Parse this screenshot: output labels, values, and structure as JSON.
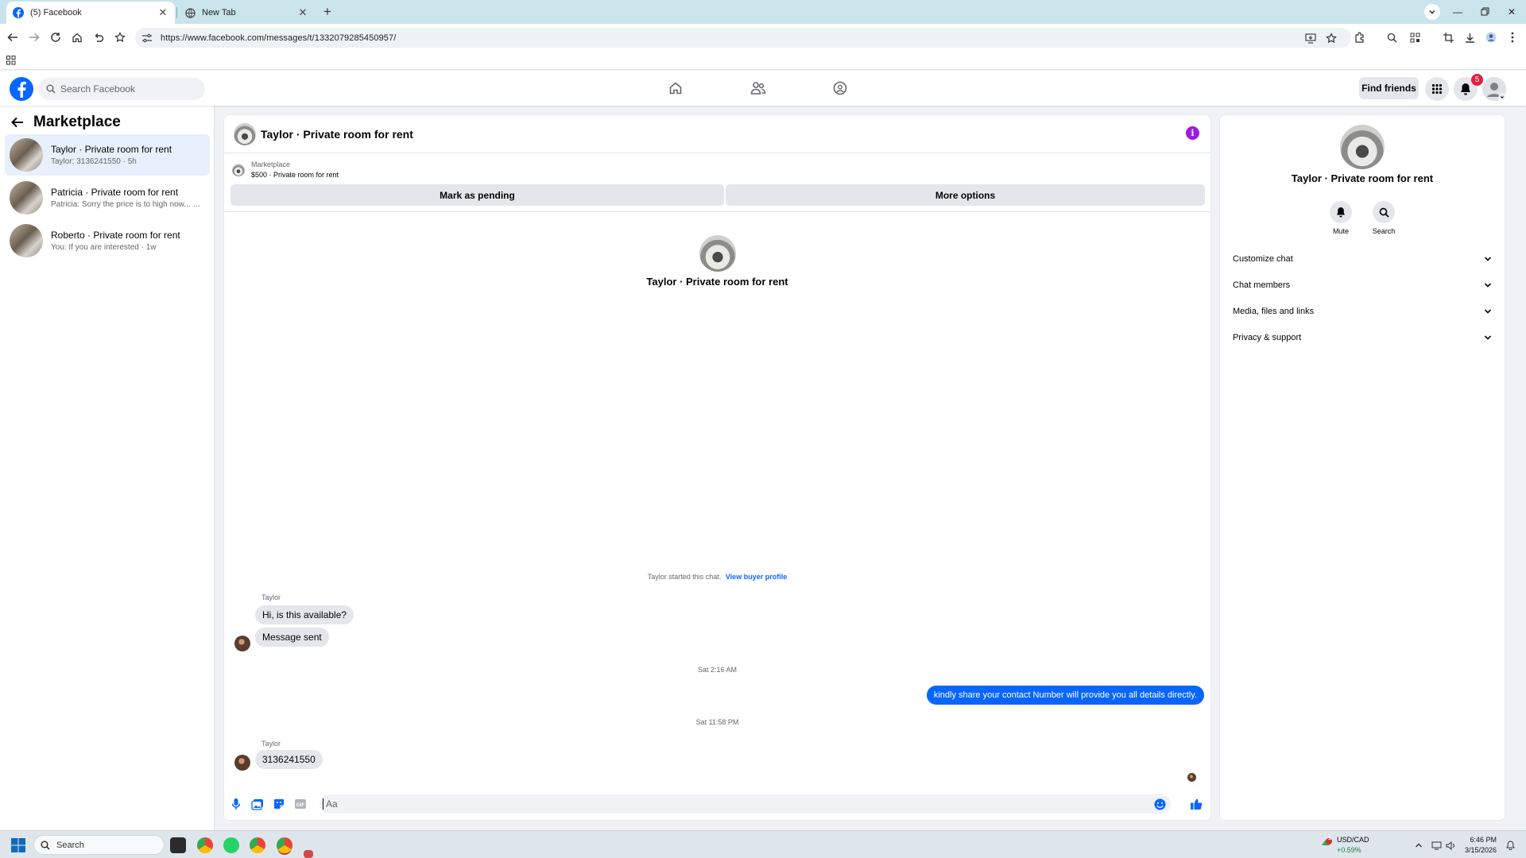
{
  "browser": {
    "tabs": [
      {
        "title": "(5) Facebook",
        "active": true
      },
      {
        "title": "New Tab",
        "active": false
      }
    ],
    "url": "https://www.facebook.com/messages/t/1332079285450957/"
  },
  "fb_header": {
    "search_placeholder": "Search Facebook",
    "find_friends_label": "Find friends",
    "notification_count": "5",
    "brand_color": "#0866ff"
  },
  "sidebar": {
    "title": "Marketplace",
    "conversations": [
      {
        "name": "Taylor · Private room for rent",
        "preview": "Taylor: 3136241550 · 5h",
        "active": true
      },
      {
        "name": "Patricia · Private room for rent",
        "preview": "Patricia: Sorry the price is to high now... · 1w",
        "active": false
      },
      {
        "name": "Roberto · Private room for rent",
        "preview": "You: If you are interested · 1w",
        "active": false
      }
    ]
  },
  "chat": {
    "title": "Taylor · Private room for rent",
    "listing_source": "Marketplace",
    "listing_price_title": "$500 · Private room for rent",
    "mark_pending_label": "Mark as pending",
    "more_options_label": "More options",
    "center_name": "Taylor · Private room for rent",
    "started_text": "Taylor started this chat.",
    "view_buyer_profile": "View buyer profile",
    "messages": [
      {
        "sender": "Taylor",
        "text": "Hi, is this available?"
      },
      {
        "text": "Message sent"
      },
      {
        "timestamp": "Sat 2:16 AM"
      },
      {
        "outgoing": "kindly share your contact Number will provide you all details directly."
      },
      {
        "timestamp": "Sat 11:58 PM"
      },
      {
        "sender": "Taylor",
        "text": "3136241550"
      }
    ],
    "composer_placeholder": "Aa"
  },
  "info_panel": {
    "name": "Taylor · Private room for rent",
    "mute_label": "Mute",
    "search_label": "Search",
    "rows": [
      "Customize chat",
      "Chat members",
      "Media, files and links",
      "Privacy & support"
    ]
  },
  "taskbar": {
    "search_label": "Search",
    "ticker_name": "USD/CAD",
    "ticker_change": "+0.59%",
    "ticker_badge": "1",
    "time": "6:46 PM",
    "date": "3/15/2026"
  }
}
